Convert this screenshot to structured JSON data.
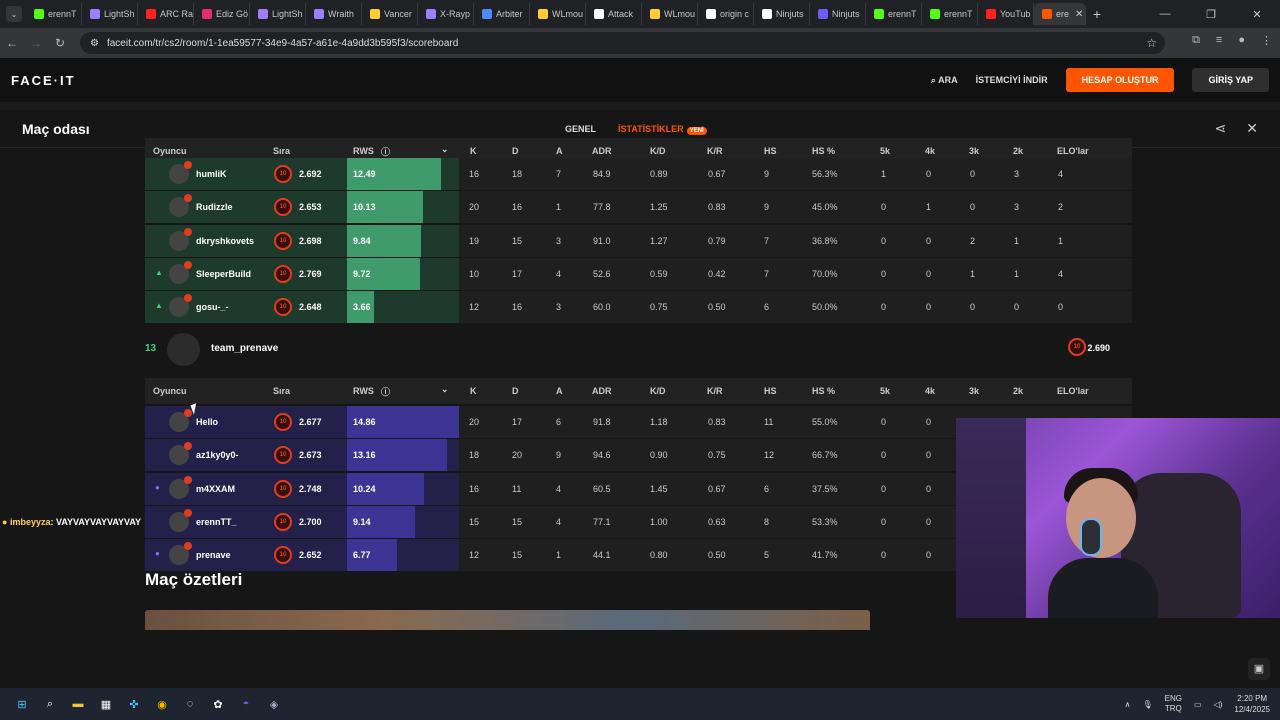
{
  "browser": {
    "tabs": [
      {
        "label": "erennT",
        "color": "#53fc18"
      },
      {
        "label": "LightSh",
        "color": "#a07cff"
      },
      {
        "label": "ARC Ra",
        "color": "#ff2020"
      },
      {
        "label": "Ediz Gö",
        "color": "#e1306c"
      },
      {
        "label": "LightSh",
        "color": "#a07cff"
      },
      {
        "label": "Wraith",
        "color": "#a07cff"
      },
      {
        "label": "Vancer",
        "color": "#ffcc33"
      },
      {
        "label": "X-Rayp",
        "color": "#a07cff"
      },
      {
        "label": "Arbiter",
        "color": "#4a8cff"
      },
      {
        "label": "WLmou",
        "color": "#ffcc33"
      },
      {
        "label": "Attack",
        "color": "#ffffff"
      },
      {
        "label": "WLmou",
        "color": "#ffcc33"
      },
      {
        "label": "origin c",
        "color": "#ffffff"
      },
      {
        "label": "Ninjuts",
        "color": "#ffffff"
      },
      {
        "label": "Ninjuts",
        "color": "#6a5cff"
      },
      {
        "label": "erennT",
        "color": "#53fc18"
      },
      {
        "label": "erennT",
        "color": "#53fc18"
      },
      {
        "label": "YouTub",
        "color": "#ff2020"
      },
      {
        "label": "ere",
        "color": "#ff5500"
      }
    ],
    "url": "faceit.com/tr/cs2/room/1-1ea59577-34e9-4a57-a61e-4a9dd3b595f3/scoreboard"
  },
  "header": {
    "logo": "FACE·IT",
    "search": "ARA",
    "client": "İSTEMCİYİ İNDİR",
    "signup": "HESAP OLUŞTUR",
    "login": "GİRİŞ YAP"
  },
  "modal": {
    "title": "Maç odası",
    "tab_general": "GENEL",
    "tab_stats": "İSTATİSTİKLER",
    "new_badge": "YENİ"
  },
  "columns": {
    "player": "Oyuncu",
    "rank": "Sıra",
    "rws": "RWS",
    "k": "K",
    "d": "D",
    "a": "A",
    "adr": "ADR",
    "kd": "K/D",
    "kr": "K/R",
    "hs": "HS",
    "hsp": "HS %",
    "k5": "5k",
    "k4": "4k",
    "k3": "3k",
    "k2": "2k",
    "elo": "ELO'lar"
  },
  "team1": {
    "rows": [
      {
        "name": "humliK",
        "level": "10",
        "elo": "2.692",
        "rws": "12.49",
        "rws_frac": 0.84,
        "k": "16",
        "d": "18",
        "a": "7",
        "adr": "84.9",
        "kd": "0.89",
        "kr": "0.67",
        "hs": "9",
        "hsp": "56.3%",
        "k5": "1",
        "k4": "0",
        "k3": "0",
        "k2": "3",
        "elo_change": "4",
        "mark": ""
      },
      {
        "name": "Rudizzle",
        "level": "10",
        "elo": "2.653",
        "rws": "10.13",
        "rws_frac": 0.68,
        "k": "20",
        "d": "16",
        "a": "1",
        "adr": "77.8",
        "kd": "1.25",
        "kr": "0.83",
        "hs": "9",
        "hsp": "45.0%",
        "k5": "0",
        "k4": "1",
        "k3": "0",
        "k2": "3",
        "elo_change": "2",
        "mark": ""
      },
      {
        "name": "dkryshkovets",
        "level": "10",
        "elo": "2.698",
        "rws": "9.84",
        "rws_frac": 0.66,
        "k": "19",
        "d": "15",
        "a": "3",
        "adr": "91.0",
        "kd": "1.27",
        "kr": "0.79",
        "hs": "7",
        "hsp": "36.8%",
        "k5": "0",
        "k4": "0",
        "k3": "2",
        "k2": "1",
        "elo_change": "1",
        "mark": ""
      },
      {
        "name": "SleeperBuild",
        "level": "10",
        "elo": "2.769",
        "rws": "9.72",
        "rws_frac": 0.65,
        "k": "10",
        "d": "17",
        "a": "4",
        "adr": "52.6",
        "kd": "0.59",
        "kr": "0.42",
        "hs": "7",
        "hsp": "70.0%",
        "k5": "0",
        "k4": "0",
        "k3": "1",
        "k2": "1",
        "elo_change": "4",
        "mark": "▲"
      },
      {
        "name": "gosu-_-",
        "level": "10",
        "elo": "2.648",
        "rws": "3.66",
        "rws_frac": 0.24,
        "k": "12",
        "d": "16",
        "a": "3",
        "adr": "60.0",
        "kd": "0.75",
        "kr": "0.50",
        "hs": "6",
        "hsp": "50.0%",
        "k5": "0",
        "k4": "0",
        "k3": "0",
        "k2": "0",
        "elo_change": "0",
        "mark": "▲"
      }
    ]
  },
  "team2": {
    "score": "13",
    "name": "team_prenave",
    "level": "10",
    "avg_elo": "2.690",
    "rows": [
      {
        "name": "Hello",
        "level": "10",
        "elo": "2.677",
        "rws": "14.86",
        "rws_frac": 1.0,
        "k": "20",
        "d": "17",
        "a": "6",
        "adr": "91.8",
        "kd": "1.18",
        "kr": "0.83",
        "hs": "11",
        "hsp": "55.0%",
        "k5": "0",
        "k4": "0",
        "mark": ""
      },
      {
        "name": "az1ky0y0-",
        "level": "10",
        "elo": "2.673",
        "rws": "13.16",
        "rws_frac": 0.89,
        "k": "18",
        "d": "20",
        "a": "9",
        "adr": "94.6",
        "kd": "0.90",
        "kr": "0.75",
        "hs": "12",
        "hsp": "66.7%",
        "k5": "0",
        "k4": "0",
        "mark": ""
      },
      {
        "name": "m4XXAM",
        "level": "10",
        "elo": "2.748",
        "rws": "10.24",
        "rws_frac": 0.69,
        "k": "16",
        "d": "11",
        "a": "4",
        "adr": "60.5",
        "kd": "1.45",
        "kr": "0.67",
        "hs": "6",
        "hsp": "37.5%",
        "k5": "0",
        "k4": "0",
        "mark": "●"
      },
      {
        "name": "erennTT_",
        "level": "10",
        "elo": "2.700",
        "rws": "9.14",
        "rws_frac": 0.61,
        "k": "15",
        "d": "15",
        "a": "4",
        "adr": "77.1",
        "kd": "1.00",
        "kr": "0.63",
        "hs": "8",
        "hsp": "53.3%",
        "k5": "0",
        "k4": "0",
        "mark": ""
      },
      {
        "name": "prenave",
        "level": "10",
        "elo": "2.652",
        "rws": "6.77",
        "rws_frac": 0.45,
        "k": "12",
        "d": "15",
        "a": "1",
        "adr": "44.1",
        "kd": "0.80",
        "kr": "0.50",
        "hs": "5",
        "hsp": "41.7%",
        "k5": "0",
        "k4": "0",
        "mark": "●"
      }
    ]
  },
  "summaries_title": "Maç özetleri",
  "chat": {
    "nick": "imbeyyza",
    "message": ": VAYVAYVAYVAYVAY"
  },
  "taskbar": {
    "lang1": "ENG",
    "lang2": "TRQ",
    "time": "2:20 PM",
    "date": "12/4/2025"
  },
  "colors": {
    "team1_fill": "#3f9a6c",
    "team1_bg": "#1e3a2c",
    "team2_fill": "#3d3596",
    "team2_bg": "#23204a",
    "accent": "#ff5500"
  }
}
